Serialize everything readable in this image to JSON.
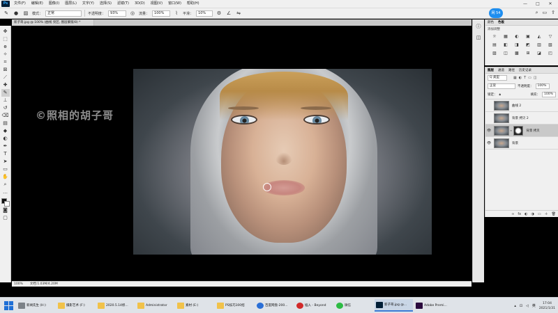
{
  "menubar": {
    "logo": "Ps",
    "items": [
      "文件(F)",
      "编辑(E)",
      "图像(I)",
      "图层(L)",
      "文字(Y)",
      "选择(S)",
      "滤镜(T)",
      "3D(D)",
      "视图(V)",
      "窗口(W)",
      "帮助(H)"
    ],
    "controls": [
      "—",
      "□",
      "✕"
    ]
  },
  "options": {
    "mode_label": "模式：",
    "mode_value": "正常",
    "opacity_label": "不透明度：",
    "opacity_value": "93%",
    "flow_label": "流量：",
    "flow_value": "100%",
    "smooth_label": "平滑：",
    "smooth_value": "10%",
    "badge": "网 54"
  },
  "document": {
    "tab_label": "新子哥.jpg @ 100% (曲线 亮区, 图层蒙版/8) *",
    "watermark": "©照相的胡子哥",
    "status_zoom": "100%",
    "status_doc": "文档:1.03M/4.20M"
  },
  "adjustments": {
    "tabs": [
      "颜色",
      "色板"
    ],
    "title": "添加调整",
    "icons": [
      "☼",
      "▦",
      "◐",
      "▣",
      "◭",
      "▽",
      "▤",
      "◧",
      "◨",
      "◩",
      "▥",
      "▧",
      "▨",
      "◫",
      "▩",
      "⊞",
      "◪",
      "◰"
    ]
  },
  "layers": {
    "tabs": [
      "图层",
      "通道",
      "路径",
      "历史记录"
    ],
    "kind_label": "Q 类型",
    "blend_mode": "正常",
    "opacity_label": "不透明度：",
    "opacity_value": "100%",
    "lock_label": "锁定：",
    "fill_label": "填充：",
    "fill_value": "100%",
    "items": [
      {
        "name": "曲线 2",
        "visible": false,
        "has_mask": false,
        "selected": false
      },
      {
        "name": "背景 拷贝 2",
        "visible": false,
        "has_mask": false,
        "selected": false
      },
      {
        "name": "背景 拷贝",
        "visible": true,
        "has_mask": true,
        "selected": true
      },
      {
        "name": "背景",
        "visible": true,
        "has_mask": false,
        "selected": false
      }
    ],
    "footer_icons": [
      "∞",
      "fx",
      "◐",
      "◑",
      "▭",
      "＋",
      "🗑"
    ]
  },
  "taskbar": {
    "items": [
      {
        "label": "新闻先生 (H:)",
        "icon": "gray"
      },
      {
        "label": "摄影艺术 (F:)",
        "icon": "folder"
      },
      {
        "label": "2020.5.14修...",
        "icon": "folder"
      },
      {
        "label": "Administrator",
        "icon": "folder"
      },
      {
        "label": "素材 (E:)",
        "icon": "folder"
      },
      {
        "label": "PS技巧100招",
        "icon": "folder"
      },
      {
        "label": "百度网盘-200...",
        "icon": "blue"
      },
      {
        "label": "插入 - Beyond",
        "icon": "red"
      },
      {
        "label": "微信",
        "icon": "wechat"
      },
      {
        "label": "新子哥.jpg @...",
        "icon": "ps",
        "active": true
      },
      {
        "label": "Adobe Premi...",
        "icon": "pr"
      }
    ],
    "clock_time": "17:04",
    "clock_date": "2021/1/31",
    "tray_text": "英"
  }
}
